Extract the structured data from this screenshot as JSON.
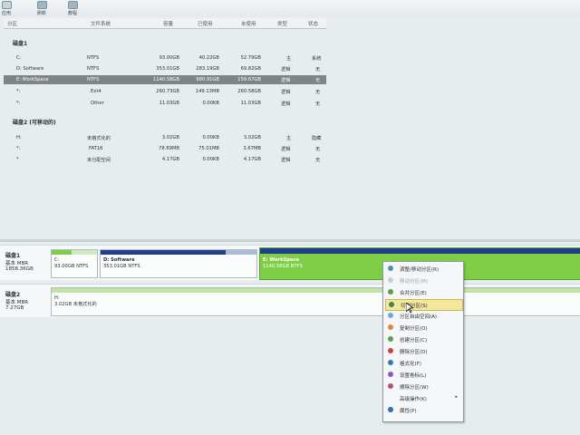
{
  "toolbar": {
    "items": [
      {
        "label": "应用"
      },
      {
        "label": "刷新"
      },
      {
        "label": "教程"
      }
    ]
  },
  "table": {
    "headers": [
      "分区",
      "文件系统",
      "容量",
      "已使用",
      "未使用",
      "类型",
      "状态"
    ],
    "disk1_title": "磁盘1",
    "disk2_title": "磁盘2 (可移动的)",
    "disk1_rows": [
      [
        "C:",
        "NTFS",
        "93.00GB",
        "40.22GB",
        "52.79GB",
        "主",
        "系统"
      ],
      [
        "D: Software",
        "NTFS",
        "353.01GB",
        "283.19GB",
        "69.82GB",
        "逻辑",
        "无"
      ],
      [
        "E: WorkSpace",
        "NTFS",
        "1140.58GB",
        "980.91GB",
        "159.67GB",
        "逻辑",
        "无"
      ],
      [
        "*:",
        "Ext4",
        "260.73GB",
        "149.13MB",
        "260.58GB",
        "逻辑",
        "无"
      ],
      [
        "*:",
        "Other",
        "11.03GB",
        "0.00KB",
        "11.03GB",
        "逻辑",
        "无"
      ]
    ],
    "disk2_rows": [
      [
        "H:",
        "未格式化的",
        "3.02GB",
        "0.00KB",
        "3.02GB",
        "主",
        "隐藏"
      ],
      [
        "*:",
        "FAT16",
        "78.69MB",
        "75.01MB",
        "3.67MB",
        "逻辑",
        "无"
      ],
      [
        "*",
        "未分配空间",
        "4.17GB",
        "0.00KB",
        "4.17GB",
        "逻辑",
        "无"
      ]
    ]
  },
  "diskmap": {
    "disk1": {
      "name": "磁盘1",
      "type": "基本 MBR",
      "size": "1858.36GB"
    },
    "disk2": {
      "name": "磁盘2",
      "type": "基本 MBR",
      "size": "7.27GB"
    },
    "parts1": [
      {
        "name": "C:",
        "info": "93.00GB NTFS",
        "used": 0.43
      },
      {
        "name": "D: Software",
        "info": "353.01GB NTFS",
        "used": 0.8
      },
      {
        "name": "E: WorkSpace",
        "info": "1140.58GB NTFS",
        "used": 0.86
      }
    ],
    "parts2": [
      {
        "name": "H:",
        "info": "3.02GB 未格式化的"
      }
    ]
  },
  "context_menu": {
    "items": [
      {
        "label": "调整/移动分区(R)",
        "enabled": true
      },
      {
        "label": "移动分区(M)",
        "enabled": false
      },
      {
        "label": "合并分区(E)",
        "enabled": true
      },
      {
        "label": "切割分区(S)",
        "enabled": true,
        "highlighted": true
      },
      {
        "label": "分区自由空间(A)",
        "enabled": true
      },
      {
        "label": "复制分区(O)",
        "enabled": true
      },
      {
        "label": "创建分区(C)",
        "enabled": true
      },
      {
        "label": "删除分区(D)",
        "enabled": true
      },
      {
        "label": "格式化(F)",
        "enabled": true
      },
      {
        "label": "设置卷标(L)",
        "enabled": true
      },
      {
        "label": "擦除分区(W)",
        "enabled": true
      },
      {
        "label": "高级操作(K)",
        "enabled": true,
        "submenu": true
      },
      {
        "label": "属性(P)",
        "enabled": true
      }
    ]
  },
  "colors": {
    "used_green": "#7fcf46",
    "used_blue": "#1f3f8a",
    "highlight": "#f2e79a"
  }
}
